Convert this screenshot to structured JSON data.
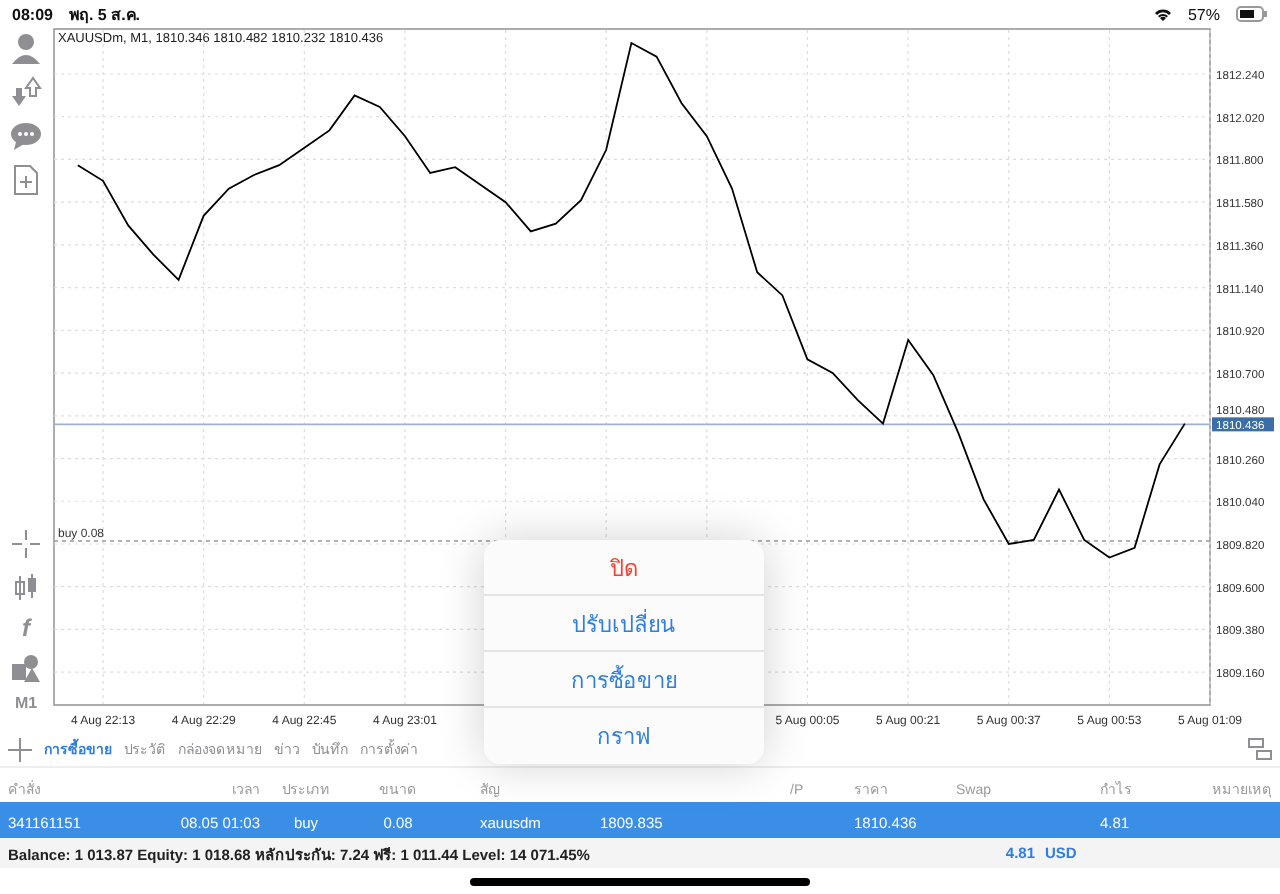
{
  "status_bar": {
    "time": "08:09",
    "date": "พฤ. 5 ส.ค.",
    "battery": "57%"
  },
  "left_toolbar": {
    "indicator_glyph": "f",
    "timeframe": "M1"
  },
  "chart": {
    "title": "XAUUSDm, M1, 1810.346 1810.482 1810.232 1810.436",
    "chart_data": {
      "type": "line",
      "categories": [
        null,
        "4 Aug 22:13",
        null,
        null,
        null,
        "4 Aug 22:29",
        null,
        null,
        null,
        "4 Aug 22:45",
        null,
        null,
        null,
        "4 Aug 23:01",
        null,
        null,
        null,
        null,
        null,
        null,
        null,
        null,
        null,
        null,
        null,
        null,
        null,
        null,
        null,
        "5 Aug 00:05",
        null,
        null,
        null,
        "5 Aug 00:21",
        null,
        null,
        null,
        "5 Aug 00:37",
        null,
        null,
        null,
        "5 Aug 00:53",
        null,
        null,
        null,
        "5 Aug 01:09"
      ],
      "series": [
        {
          "color": "#000000",
          "values": [
            1811.77,
            1811.69,
            1811.46,
            1811.31,
            1811.18,
            1811.51,
            1811.65,
            1811.72,
            1811.77,
            1811.86,
            1811.95,
            1812.13,
            1812.07,
            1811.92,
            1811.73,
            1811.76,
            1811.67,
            1811.58,
            1811.43,
            1811.47,
            1811.59,
            1811.85,
            1812.4,
            1812.33,
            1812.09,
            1811.92,
            1811.65,
            1811.22,
            1811.1,
            1810.77,
            1810.7,
            1810.56,
            1810.44,
            1810.87,
            1810.69,
            1810.39,
            1810.05,
            1809.82,
            1809.84,
            1810.1,
            1809.84,
            1809.75,
            1809.8,
            1810.23,
            1810.44,
            null
          ]
        }
      ],
      "ylim": [
        1808.996,
        1812.477
      ],
      "yticks": [
        {
          "value": 1812.24,
          "label": "1812.240"
        },
        {
          "value": 1812.02,
          "label": "1812.020"
        },
        {
          "value": 1811.8,
          "label": "1811.800"
        },
        {
          "value": 1811.58,
          "label": "1811.580"
        },
        {
          "value": 1811.36,
          "label": "1811.360"
        },
        {
          "value": 1811.14,
          "label": "1811.140"
        },
        {
          "value": 1810.92,
          "label": "1810.920"
        },
        {
          "value": 1810.7,
          "label": "1810.700"
        },
        {
          "value": 1810.48,
          "label": "1810.480"
        },
        {
          "value": 1810.26,
          "label": "1810.260"
        },
        {
          "value": 1810.04,
          "label": "1810.040"
        },
        {
          "value": 1809.82,
          "label": "1809.820"
        },
        {
          "value": 1809.6,
          "label": "1809.600"
        },
        {
          "value": 1809.38,
          "label": "1809.380"
        },
        {
          "value": 1809.16,
          "label": "1809.160"
        }
      ],
      "grid": true,
      "ref_lines": [
        {
          "axis": "y",
          "value": 1810.436,
          "label": "1810.436"
        },
        {
          "axis": "y",
          "value": 1809.835,
          "label": "buy 0.08"
        }
      ]
    }
  },
  "popover_menu": [
    {
      "label": "ปิด",
      "kind": "destructive"
    },
    {
      "label": "ปรับเปลี่ยน",
      "kind": "action"
    },
    {
      "label": "การซื้อขาย",
      "kind": "action"
    },
    {
      "label": "กราฟ",
      "kind": "action"
    }
  ],
  "tabs": [
    {
      "label": "การซื้อขาย",
      "selected": true
    },
    {
      "label": "ประวัติ",
      "selected": false
    },
    {
      "label": "กล่องจดหมาย",
      "selected": false
    },
    {
      "label": "ข่าว",
      "selected": false
    },
    {
      "label": "บันทึก",
      "selected": false
    },
    {
      "label": "การตั้งค่า",
      "selected": false
    }
  ],
  "table": {
    "columns": [
      {
        "header": "คำสั่ง"
      },
      {
        "header": "เวลา"
      },
      {
        "header": "ประเภท"
      },
      {
        "header": "ขนาด"
      },
      {
        "header": "สัญ"
      },
      {},
      {},
      {
        "header": "/P"
      },
      {
        "header": "ราคา"
      },
      {
        "header": "Swap"
      },
      {
        "header": "กำไร"
      },
      {
        "header": "หมายเหตุ"
      }
    ],
    "rows": [
      {
        "selected": true,
        "cells": [
          {
            "text": "341161151"
          },
          {
            "text": "08.05 01:03"
          },
          {
            "text": "buy"
          },
          {
            "text": "0.08"
          },
          {
            "text": "xauusdm"
          },
          {
            "text": "1809.835"
          },
          {},
          {},
          {
            "text": "1810.436"
          },
          {},
          {
            "text": "4.81"
          },
          {}
        ]
      }
    ]
  },
  "summary": {
    "text": "Balance: 1 013.87 Equity: 1 018.68 หลักประกัน: 7.24 ฟรี: 1 011.44 Level: 14 071.45%",
    "profit": "4.81",
    "currency": "USD"
  }
}
